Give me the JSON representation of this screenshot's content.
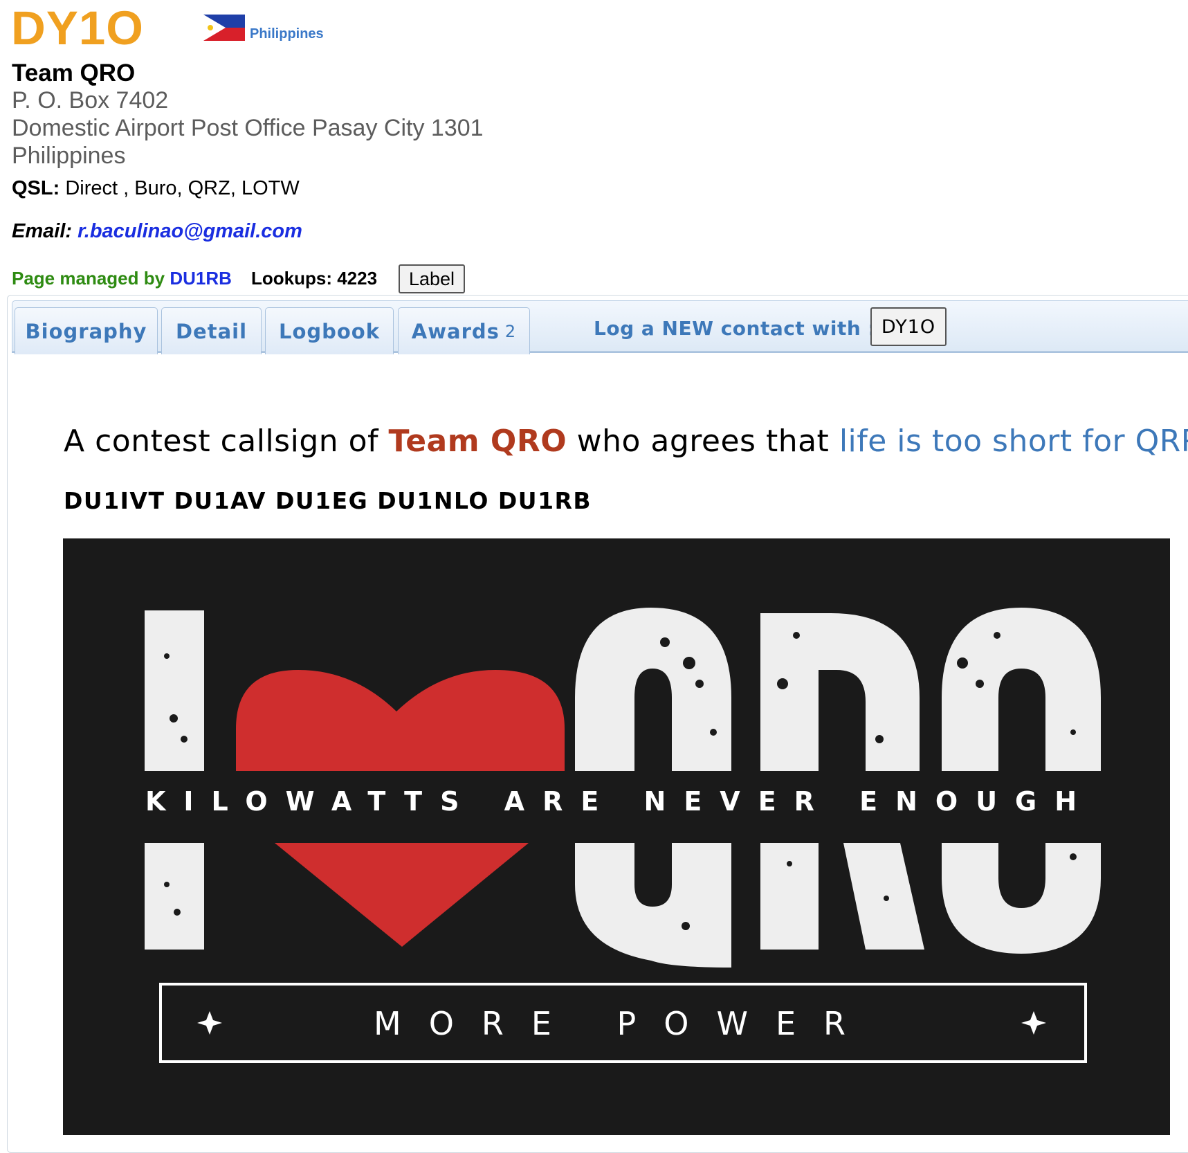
{
  "header": {
    "callsign": "DY1O",
    "country": "Philippines",
    "owner": "Team QRO",
    "address": [
      "P. O. Box 7402",
      "Domestic Airport Post Office Pasay City 1301",
      "Philippines"
    ],
    "qsl_label": "QSL:",
    "qsl_value": "Direct , Buro, QRZ, LOTW",
    "email_label": "Email:",
    "email_value": "r.baculinao@gmail.com",
    "managed_prefix": "Page managed by",
    "managed_by": "DU1RB",
    "lookups": "Lookups: 4223",
    "label_button": "Label"
  },
  "tabs": [
    {
      "label": "Biography"
    },
    {
      "label": "Detail"
    },
    {
      "label": "Logbook"
    },
    {
      "label": "Awards",
      "count": "2"
    }
  ],
  "log_contact": {
    "label": "Log a NEW contact with :",
    "callsign": "DY1O"
  },
  "biography": {
    "intro_pre": "A contest callsign of",
    "intro_team": "Team QRO",
    "intro_mid": "who agrees that",
    "intro_motto": "life is too short for QRP.",
    "members": "DU1IVT  DU1AV  DU1EG  DU1NLO  DU1RB"
  },
  "banner": {
    "headline_left": "I",
    "headline_right": "QRO",
    "tagline": "KILOWATTS ARE NEVER ENOUGH",
    "slogan": "MORE POWER",
    "heart_color": "#cf2e2e",
    "background_color": "#1a1a1a",
    "letter_color": "#eeeeee"
  },
  "colors": {
    "callsign": "#f0a020",
    "link": "#1a2ee0",
    "managed": "#2e8b12",
    "tab_text": "#3d78b9",
    "team": "#b03a1e"
  }
}
